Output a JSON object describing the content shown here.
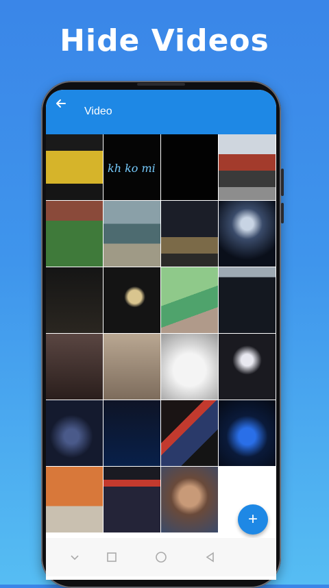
{
  "headline": "Hide Videos",
  "appbar": {
    "title": "Video",
    "back_icon": "arrow-left-icon",
    "color": "#1e88e5"
  },
  "fab": {
    "label": "+",
    "icon": "plus-icon"
  },
  "grid": {
    "thumb_label": "kh ko mi",
    "thumbnails": [
      {
        "desc": "yellow cartoon frame"
      },
      {
        "desc": "colorful text on black"
      },
      {
        "desc": "black frame"
      },
      {
        "desc": "storefront building"
      },
      {
        "desc": "ball on grass"
      },
      {
        "desc": "sea shore"
      },
      {
        "desc": "city tower at night"
      },
      {
        "desc": "fireworks"
      },
      {
        "desc": "rain at night"
      },
      {
        "desc": "dark night bag"
      },
      {
        "desc": "green field hand"
      },
      {
        "desc": "car dashboard"
      },
      {
        "desc": "dim room"
      },
      {
        "desc": "sketch on carpet"
      },
      {
        "desc": "drawn heart"
      },
      {
        "desc": "car screen"
      },
      {
        "desc": "speedometer"
      },
      {
        "desc": "dark blue phone"
      },
      {
        "desc": "phone rgb"
      },
      {
        "desc": "blue diamond screen"
      },
      {
        "desc": "person in orange"
      },
      {
        "desc": "phone display"
      },
      {
        "desc": "child portrait"
      },
      {
        "desc": "empty"
      }
    ]
  },
  "navbar": {
    "icons": [
      "chevron-down-icon",
      "square-icon",
      "circle-icon",
      "triangle-back-icon"
    ]
  }
}
